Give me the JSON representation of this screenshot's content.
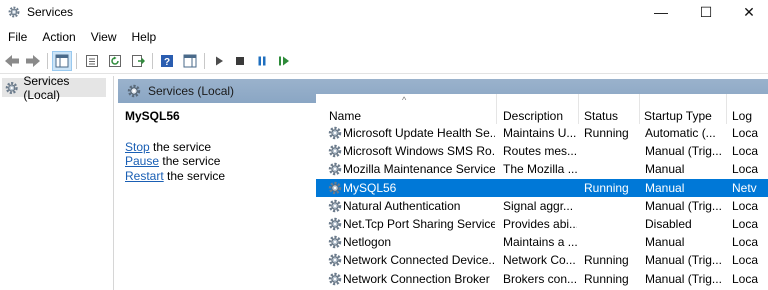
{
  "window": {
    "title": "Services",
    "minimize": "—",
    "maximize": "☐",
    "close": "✕"
  },
  "menu": [
    "File",
    "Action",
    "View",
    "Help"
  ],
  "toolbar": {
    "buttons": [
      "back-icon",
      "forward-icon",
      "show-hide-console-tree-icon",
      "properties-icon",
      "refresh-icon",
      "export-list-icon",
      "help-icon",
      "show-hide-action-pane-icon",
      "start-service-icon",
      "stop-service-icon",
      "pause-service-icon",
      "restart-service-icon"
    ]
  },
  "tree": {
    "selected_item": "Services (Local)"
  },
  "pane": {
    "header_title": "Services (Local)"
  },
  "description": {
    "service_name": "MySQL56",
    "actions": [
      {
        "link": "Stop",
        "rest": " the service"
      },
      {
        "link": "Pause",
        "rest": " the service"
      },
      {
        "link": "Restart",
        "rest": " the service"
      }
    ]
  },
  "table": {
    "columns": [
      "Name",
      "Description",
      "Status",
      "Startup Type",
      "Log"
    ],
    "sorted_column": "Name",
    "sort_indicator": "^",
    "rows": [
      {
        "name": "Microsoft Update Health Se...",
        "description": "Maintains U...",
        "status": "Running",
        "startup": "Automatic (...",
        "logon": "Loca"
      },
      {
        "name": "Microsoft Windows SMS Ro...",
        "description": "Routes mes...",
        "status": "",
        "startup": "Manual (Trig...",
        "logon": "Loca"
      },
      {
        "name": "Mozilla Maintenance Service",
        "description": "The Mozilla ...",
        "status": "",
        "startup": "Manual",
        "logon": "Loca"
      },
      {
        "name": "MySQL56",
        "description": "",
        "status": "Running",
        "startup": "Manual",
        "logon": "Netv",
        "selected": true
      },
      {
        "name": "Natural Authentication",
        "description": "Signal aggr...",
        "status": "",
        "startup": "Manual (Trig...",
        "logon": "Loca"
      },
      {
        "name": "Net.Tcp Port Sharing Service",
        "description": "Provides abi...",
        "status": "",
        "startup": "Disabled",
        "logon": "Loca"
      },
      {
        "name": "Netlogon",
        "description": "Maintains a ...",
        "status": "",
        "startup": "Manual",
        "logon": "Loca"
      },
      {
        "name": "Network Connected Device...",
        "description": "Network Co...",
        "status": "Running",
        "startup": "Manual (Trig...",
        "logon": "Loca"
      },
      {
        "name": "Network Connection Broker",
        "description": "Brokers con...",
        "status": "Running",
        "startup": "Manual (Trig...",
        "logon": "Loca"
      }
    ]
  },
  "colors": {
    "selection": "#0078d7",
    "pane_header": "#8aa6c4",
    "link": "#1a5fb4"
  }
}
